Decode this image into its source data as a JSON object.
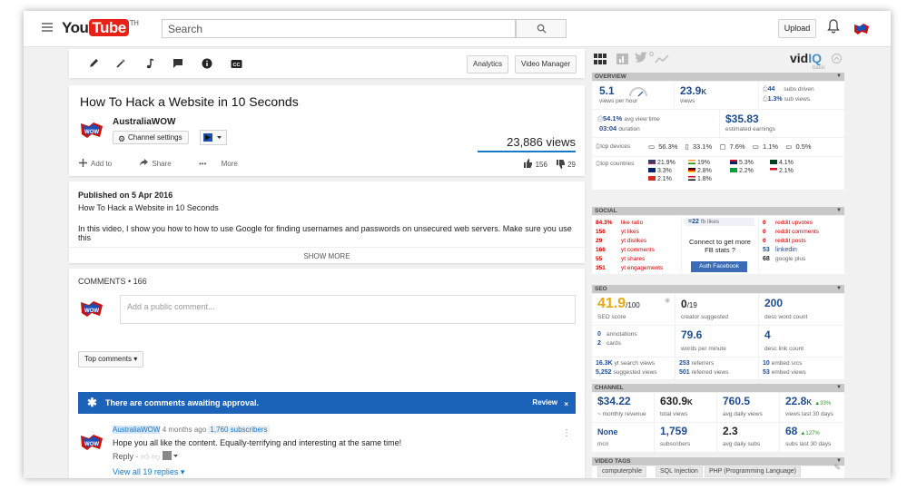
{
  "header": {
    "logo_you": "You",
    "logo_tube": "Tube",
    "logo_tm": "TH",
    "search_placeholder": "Search",
    "upload_label": "Upload"
  },
  "toolbar": {
    "analytics_label": "Analytics",
    "video_manager_label": "Video Manager"
  },
  "video": {
    "title": "How To Hack a Website in 10 Seconds",
    "channel_name": "AustraliaWOW",
    "channel_settings_label": "Channel settings",
    "views": "23,886 views",
    "add_to": "Add to",
    "share": "Share",
    "more": "More",
    "likes": "156",
    "dislikes": "29"
  },
  "description": {
    "published": "Published on 5 Apr 2016",
    "line1": "How To Hack a Website in 10 Seconds",
    "line2": "In this video, I show you how to how to use Google for finding usernames and passwords on unsecured web servers. Make sure you use this",
    "show_more": "SHOW MORE"
  },
  "comments": {
    "header": "COMMENTS • 166",
    "placeholder": "Add a public comment...",
    "sort_label": "Top comments",
    "banner_text": "There are comments awaiting approval.",
    "review_label": "Review",
    "close_label": "×",
    "first": {
      "author": "AustraliaWOW",
      "age": "4 months ago",
      "subs": "1,760 subscribers",
      "text": "Hope you all like the content. Equally-terrifying and interesting at the same time!",
      "reply": "Reply",
      "view_all": "View all 19 replies"
    }
  },
  "vidiq": {
    "logo_vid": "vid",
    "logo_iq": "IQ",
    "logo_sub": "basic",
    "overview": {
      "title": "OVERVIEW",
      "vph": "5.1",
      "vph_label": "views per hour",
      "views": "23.9",
      "views_unit": "K",
      "views_label": "views",
      "subs_driven": "44",
      "subs_driven_label": "subs driven",
      "sub_views": "1.3%",
      "sub_views_label": "sub views",
      "avd": "54.1%",
      "avd_label": "avg view time",
      "duration": "03:04",
      "duration_label": "duration",
      "earnings": "$35.83",
      "earnings_label": "estimated earnings",
      "devices_label": "top devices",
      "dev1": "56.3%",
      "dev2": "33.1%",
      "dev3": "7.6%",
      "dev4": "1.1%",
      "dev5": "0.5%",
      "countries_label": "top countries",
      "c1": "21.9%",
      "c2": "19%",
      "c3": "5.3%",
      "c4": "4.1%",
      "c5": "3.3%",
      "c6": "2.8%",
      "c7": "2.2%",
      "c8": "2.1%",
      "c9": "2.1%",
      "c10": "1.8%"
    },
    "social": {
      "title": "SOCIAL",
      "like_ratio": "84.3%",
      "like_ratio_label": "like ratio",
      "yt_likes": "156",
      "yt_likes_label": "yt likes",
      "yt_dislikes": "29",
      "yt_dislikes_label": "yt dislikes",
      "yt_comments": "166",
      "yt_comments_label": "yt comments",
      "yt_shares": "55",
      "yt_shares_label": "yt shares",
      "yt_eng": "351",
      "yt_eng_label": "yt engagements",
      "fb_likes": "=22",
      "fb_likes_label": "fb likes",
      "connect": "Connect to get more FB stats ?",
      "auth_fb": "Auth Facebook",
      "reddit_up": "0",
      "reddit_up_label": "reddit upvotes",
      "reddit_com": "0",
      "reddit_com_label": "reddit comments",
      "reddit_posts": "0",
      "reddit_posts_label": "reddit posts",
      "linkedin": "53",
      "linkedin_label": "linkedin",
      "gplus": "68",
      "gplus_label": "google plus"
    },
    "seo": {
      "title": "SEO",
      "score": "41.9",
      "score_max": "/100",
      "score_label": "SEO score",
      "creator": "0",
      "creator_max": "/19",
      "creator_label": "creator suggested",
      "desc_words": "200",
      "desc_words_label": "desc word count",
      "annotations": "0",
      "annotations_label": "annotations",
      "cards": "2",
      "cards_label": "cards",
      "wpm": "79.6",
      "wpm_label": "words per minute",
      "desc_links": "4",
      "desc_links_label": "desc link count",
      "yt_search": "16.3K",
      "yt_search_label": "yt search views",
      "suggested": "5,252",
      "suggested_label": "suggested views",
      "referrers": "253",
      "referrers_label": "referrers",
      "referred": "501",
      "referred_label": "referred views",
      "embed_srcs": "10",
      "embed_srcs_label": "embed srcs",
      "embed_views": "53",
      "embed_views_label": "embed views"
    },
    "channel": {
      "title": "CHANNEL",
      "monthly": "$34.22",
      "monthly_label": "~ monthly revenue",
      "total_views": "630.9",
      "total_views_unit": "K",
      "total_views_label": "total views",
      "avg_daily_views": "760.5",
      "avg_daily_views_label": "avg daily views",
      "views_30": "22.8",
      "views_30_unit": "K",
      "views_30_delta": "▲33%",
      "views_30_label": "views last 30 days",
      "mcn": "None",
      "mcn_label": "mcn",
      "subscribers": "1,759",
      "subscribers_label": "subscribers",
      "avg_daily_subs": "2.3",
      "avg_daily_subs_label": "avg daily subs",
      "subs_30": "68",
      "subs_30_delta": "▲127%",
      "subs_30_label": "subs last 30 days"
    },
    "tags": {
      "title": "VIDEO TAGS",
      "items": [
        "computerphile",
        "SQL Injection",
        "PHP (Programming Language)"
      ]
    }
  }
}
